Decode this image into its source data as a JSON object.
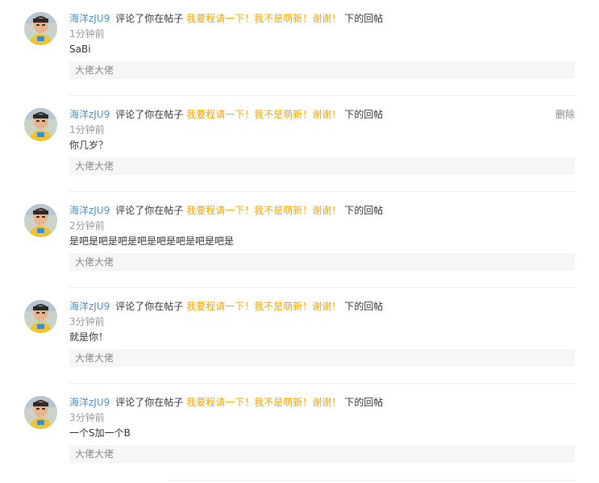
{
  "colors": {
    "username": "#4a90c8",
    "post_title": "#f0a500",
    "time": "#999999",
    "quote_bg": "#f6f6f6",
    "divider": "#eeeeee"
  },
  "notifications": [
    {
      "username": "海洋zJU9",
      "action": "评论了你在帖子",
      "post_title": "我要程请一下！我不是萌新！谢谢！",
      "suffix": "下的回帖",
      "time": "1分钟前",
      "comment": "SaBi",
      "quote": "大佬大佬",
      "delete_label": ""
    },
    {
      "username": "海洋zJU9",
      "action": "评论了你在帖子",
      "post_title": "我要程请一下！我不是萌新！谢谢！",
      "suffix": "下的回帖",
      "time": "1分钟前",
      "comment": "你几岁？",
      "quote": "大佬大佬",
      "delete_label": "删除"
    },
    {
      "username": "海洋zJU9",
      "action": "评论了你在帖子",
      "post_title": "我要程请一下！我不是萌新！谢谢！",
      "suffix": "下的回帖",
      "time": "2分钟前",
      "comment": "是吧是吧是吧是吧是吧是吧是吧是吧是",
      "quote": "大佬大佬",
      "delete_label": ""
    },
    {
      "username": "海洋zJU9",
      "action": "评论了你在帖子",
      "post_title": "我要程请一下！我不是萌新！谢谢！",
      "suffix": "下的回帖",
      "time": "3分钟前",
      "comment": "就是你！",
      "quote": "大佬大佬",
      "delete_label": ""
    },
    {
      "username": "海洋zJU9",
      "action": "评论了你在帖子",
      "post_title": "我要程请一下！我不是萌新！谢谢！",
      "suffix": "下的回帖",
      "time": "3分钟前",
      "comment": "一个S加一个B",
      "quote": "大佬大佬",
      "delete_label": ""
    }
  ]
}
